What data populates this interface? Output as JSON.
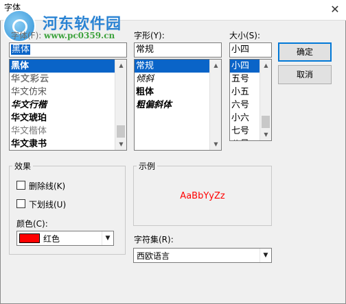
{
  "window": {
    "title": "字体",
    "close_glyph": "✕"
  },
  "watermark": {
    "site_name": "河东软件园",
    "url": "www.pc0359.cn"
  },
  "font": {
    "label": "字体(F):",
    "value": "黑体",
    "items": [
      "黑体",
      "华文彩云",
      "华文仿宋",
      "华文行楷",
      "华文琥珀",
      "华文楷体",
      "华文隶书"
    ],
    "selected": "黑体"
  },
  "style": {
    "label": "字形(Y):",
    "value": "常规",
    "items": [
      "常规",
      "倾斜",
      "粗体",
      "粗偏斜体"
    ],
    "selected": "常规"
  },
  "size": {
    "label": "大小(S):",
    "value": "小四",
    "items": [
      "小四",
      "五号",
      "小五",
      "六号",
      "小六",
      "七号",
      "八号"
    ],
    "selected": "小四"
  },
  "buttons": {
    "ok": "确定",
    "cancel": "取消"
  },
  "effects": {
    "group_label": "效果",
    "strikeout": {
      "label": "删除线(K)",
      "checked": false
    },
    "underline": {
      "label": "下划线(U)",
      "checked": false
    },
    "color_label": "颜色(C):",
    "color_value": "红色",
    "color_hex": "#ff0000"
  },
  "sample": {
    "group_label": "示例",
    "text": "AaBbYyZz",
    "color_hex": "#ff0000"
  },
  "charset": {
    "label": "字符集(R):",
    "value": "西欧语言"
  },
  "icons": {
    "scroll_up": "▲",
    "scroll_down": "▼",
    "dropdown": "▼"
  }
}
